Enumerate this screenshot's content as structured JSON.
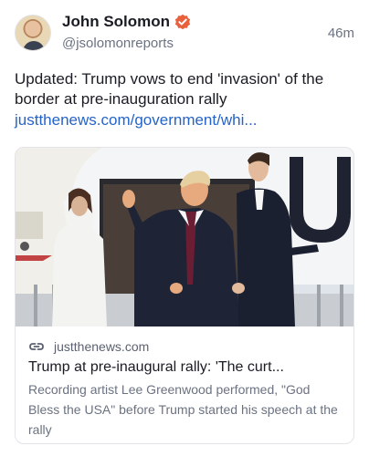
{
  "post": {
    "author_name": "John Solomon",
    "author_handle": "@jsolomonreports",
    "timestamp": "46m",
    "text": "Updated: Trump vows to end 'invasion' of the border at pre-inauguration rally",
    "link_text": "justthenews.com/government/whi..."
  },
  "card": {
    "domain": "justthenews.com",
    "title": "Trump at pre-inaugural rally: 'The curt...",
    "description": "Recording artist Lee Greenwood performed, \"God Bless the USA\" before Trump started his speech at the rally"
  },
  "icons": {
    "verified": "verified-badge-icon",
    "link": "link-icon"
  },
  "colors": {
    "link": "#2563c9",
    "verified": "#e8613c",
    "muted": "#6b7280"
  }
}
